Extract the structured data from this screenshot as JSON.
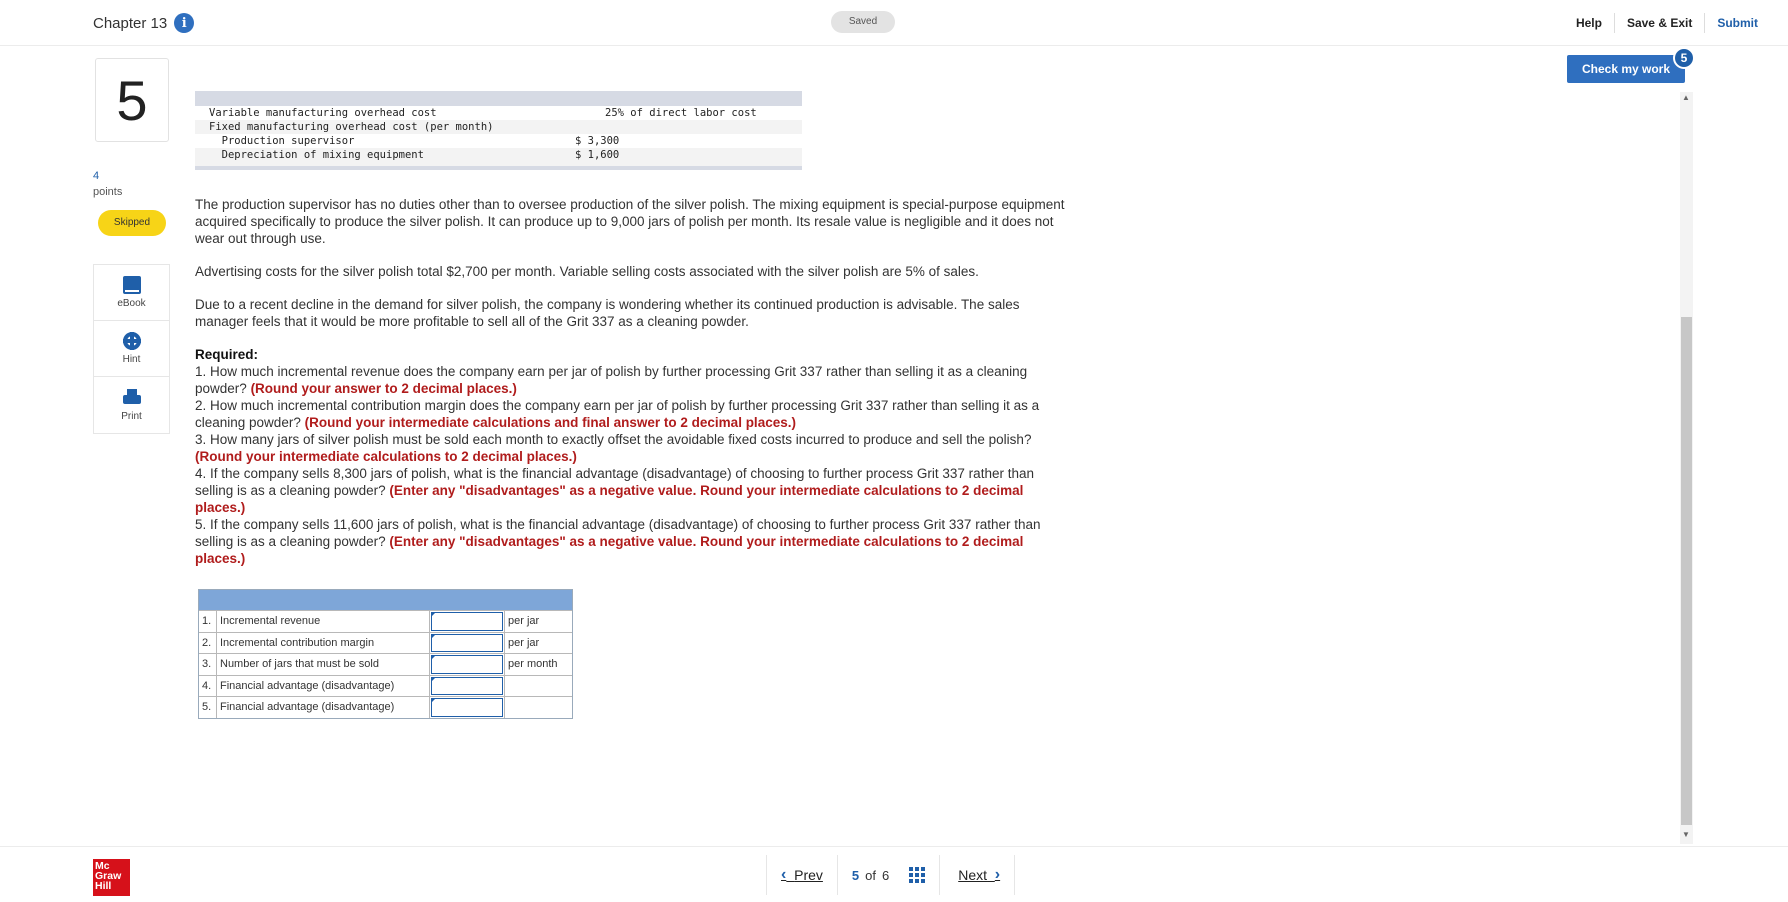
{
  "header": {
    "chapter": "Chapter 13",
    "saved": "Saved",
    "help": "Help",
    "save_exit": "Save & Exit",
    "submit": "Submit"
  },
  "question": {
    "number": "5",
    "points_value": "4",
    "points_label": "points",
    "status": "Skipped"
  },
  "tools": {
    "ebook": "eBook",
    "hint": "Hint",
    "print": "Print"
  },
  "data_table": {
    "rows": [
      {
        "label": "Variable manufacturing overhead cost",
        "value": "25% of direct labor cost"
      },
      {
        "label": "Fixed manufacturing overhead cost (per month)",
        "value": ""
      },
      {
        "label": "  Production supervisor",
        "value": "$ 3,300"
      },
      {
        "label": "  Depreciation of mixing equipment",
        "value": "$ 1,600"
      }
    ]
  },
  "text": {
    "p1": "The production supervisor has no duties other than to oversee production of the silver polish. The mixing equipment is special-purpose equipment acquired specifically to produce the silver polish. It can produce up to 9,000 jars of polish per month. Its resale value is negligible and it does not wear out through use.",
    "p2": "Advertising costs for the silver polish total $2,700 per month. Variable selling costs associated with the silver polish are 5% of sales.",
    "p3": "Due to a recent decline in the demand for silver polish, the company is wondering whether its continued production is advisable. The sales manager feels that it would be more profitable to sell all of the Grit 337 as a cleaning powder.",
    "required": "Required:",
    "q1": "1. How much incremental revenue does the company earn per jar of polish by further processing Grit 337 rather than selling it as a cleaning powder?",
    "q1_note": "(Round your answer to 2 decimal places.)",
    "q2": "2. How much incremental contribution margin does the company earn per jar of polish by further processing Grit 337 rather than selling it as a cleaning powder?",
    "q2_note": "(Round your intermediate calculations and final answer to 2 decimal places.)",
    "q3": "3. How many jars of silver polish must be sold each month to exactly offset the avoidable fixed costs incurred to produce and sell the polish?",
    "q3_note": "(Round your intermediate calculations to 2 decimal places.)",
    "q4": "4. If the company sells 8,300 jars of polish, what is the financial advantage (disadvantage) of choosing to further process Grit 337 rather than selling is as a cleaning powder?",
    "q4_note": "(Enter any \"disadvantages\" as a negative value.  Round your intermediate calculations to 2 decimal places.)",
    "q5": "5. If the company sells 11,600 jars of polish, what is the financial advantage (disadvantage) of choosing to further process Grit 337 rather than selling is as a cleaning powder?",
    "q5_note": "(Enter any \"disadvantages\" as a negative value.  Round your intermediate calculations to 2 decimal places.)"
  },
  "answer_table": {
    "rows": [
      {
        "n": "1.",
        "label": "Incremental revenue",
        "value": "",
        "unit": "per jar"
      },
      {
        "n": "2.",
        "label": "Incremental contribution margin",
        "value": "",
        "unit": "per jar"
      },
      {
        "n": "3.",
        "label": "Number of jars that must be sold",
        "value": "",
        "unit": "per month"
      },
      {
        "n": "4.",
        "label": "Financial advantage (disadvantage)",
        "value": "",
        "unit": ""
      },
      {
        "n": "5.",
        "label": "Financial advantage (disadvantage)",
        "value": "",
        "unit": ""
      }
    ]
  },
  "check": {
    "label": "Check my work",
    "badge": "5"
  },
  "footer": {
    "logo": [
      "Mc",
      "Graw",
      "Hill"
    ],
    "prev": "Prev",
    "current": "5",
    "of": "of",
    "total": "6",
    "next": "Next"
  },
  "colors": {
    "accent": "#1f5fa9",
    "skipped": "#f7d417",
    "note_red": "#b01c1c",
    "logo_red": "#d6111a"
  }
}
